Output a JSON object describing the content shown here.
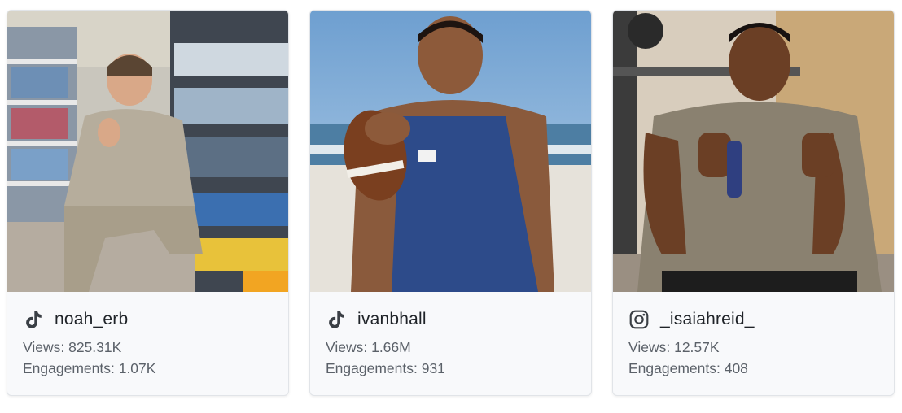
{
  "creators": [
    {
      "platform": "tiktok",
      "platform_icon": "tiktok-icon",
      "handle": "noah_erb",
      "views_label": "Views: 825.31K",
      "engagements_label": "Engagements: 1.07K"
    },
    {
      "platform": "tiktok",
      "platform_icon": "tiktok-icon",
      "handle": "ivanbhall",
      "views_label": "Views: 1.66M",
      "engagements_label": "Engagements: 931"
    },
    {
      "platform": "instagram",
      "platform_icon": "instagram-icon",
      "handle": "_isaiahreid_",
      "views_label": "Views: 12.57K",
      "engagements_label": "Engagements: 408"
    }
  ],
  "colors": {
    "card_background": "#f8f9fb",
    "card_border": "#e1e4e8",
    "handle_text": "#1f2328",
    "stat_text": "#5b6169",
    "icon": "#3a3f45"
  }
}
